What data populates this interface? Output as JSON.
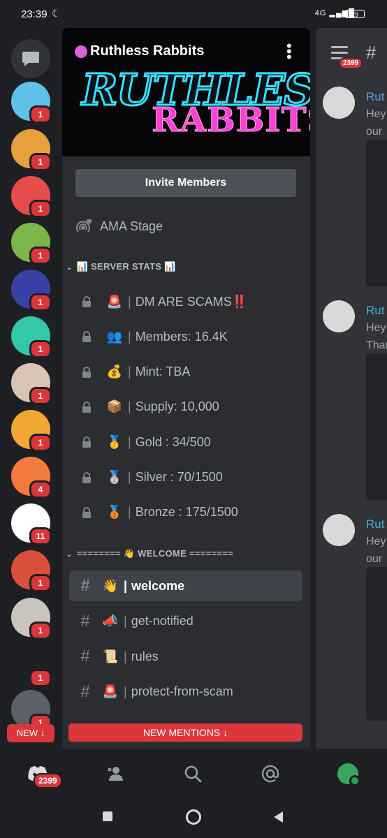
{
  "status_bar": {
    "time": "23:39",
    "network": "4G",
    "battery": "29"
  },
  "server_rail": {
    "servers": [
      {
        "name": "blue-face-server",
        "badge": "1",
        "color": "#5ec2e8"
      },
      {
        "name": "ape-server",
        "badge": "1",
        "color": "#e6a13a"
      },
      {
        "name": "discord-red-server",
        "badge": "1",
        "color": "#e74c4c"
      },
      {
        "name": "hat-character-server",
        "badge": "1",
        "color": "#7ab648"
      },
      {
        "name": "anime-girl-server",
        "badge": "1",
        "color": "#3a3fa8"
      },
      {
        "name": "ape-teal-server",
        "badge": "1",
        "color": "#34c7a8"
      },
      {
        "name": "woman-photo-server",
        "badge": "1",
        "color": "#d8c3b5"
      },
      {
        "name": "orange-ape-server",
        "badge": "1",
        "color": "#f0a832"
      },
      {
        "name": "robot-server",
        "badge": "4",
        "color": "#f17a3c"
      },
      {
        "name": "target-server",
        "badge": "11",
        "color": "#ffffff"
      },
      {
        "name": "detective-server",
        "badge": "1",
        "color": "#d94f3c"
      },
      {
        "name": "cat-girl-server",
        "badge": "1",
        "color": "#c9c4bd"
      },
      {
        "name": "turtle-server",
        "badge": "1",
        "color": "#1e1f22"
      },
      {
        "name": "discord-grey-server",
        "badge": "1",
        "color": "#5c6068"
      }
    ],
    "new_pill": "NEW ↓"
  },
  "server": {
    "name": "Ruthless Rabbits",
    "banner_logo_line1": "RUTHLESS",
    "banner_logo_line2": "RABBITS",
    "invite_label": "Invite Members",
    "stage_channel": "AMA Stage"
  },
  "categories": [
    {
      "label": "📊 SERVER STATS 📊"
    },
    {
      "label": "======== 👋 WELCOME ========"
    }
  ],
  "stat_channels": [
    {
      "emoji": "🚨",
      "text": "DM ARE SCAMS‼️"
    },
    {
      "emoji": "👥",
      "text": "Members: 16.4K"
    },
    {
      "emoji": "💰",
      "text": "Mint: TBA"
    },
    {
      "emoji": "📦",
      "text": "Supply: 10,000"
    },
    {
      "emoji": "🥇",
      "text": "Gold : 34/500"
    },
    {
      "emoji": "🥈",
      "text": "Silver : 70/1500"
    },
    {
      "emoji": "🥉",
      "text": "Bronze : 175/1500"
    }
  ],
  "text_channels": [
    {
      "emoji": "👋",
      "name": "welcome",
      "active": true
    },
    {
      "emoji": "📣",
      "name": "get-notified",
      "active": false
    },
    {
      "emoji": "📜",
      "name": "rules",
      "active": false
    },
    {
      "emoji": "🚨",
      "name": "protect-from-scam",
      "active": false
    }
  ],
  "new_mentions_label": "NEW MENTIONS ↓",
  "chat_peek": {
    "unread_badge": "2399",
    "messages": [
      {
        "name": "Rut",
        "line1": "Hey",
        "line2": "our"
      },
      {
        "name": "Rut",
        "line1": "Hey",
        "line2": "Thar"
      },
      {
        "name": "Rut",
        "line1": "Hey",
        "line2": "our"
      }
    ]
  },
  "bottom_nav": {
    "home_badge": "2399"
  },
  "colors": {
    "accent_red": "#da373c",
    "panel": "#2b2d31",
    "background": "#1e1f22",
    "link_blue": "#4aa8d8"
  }
}
